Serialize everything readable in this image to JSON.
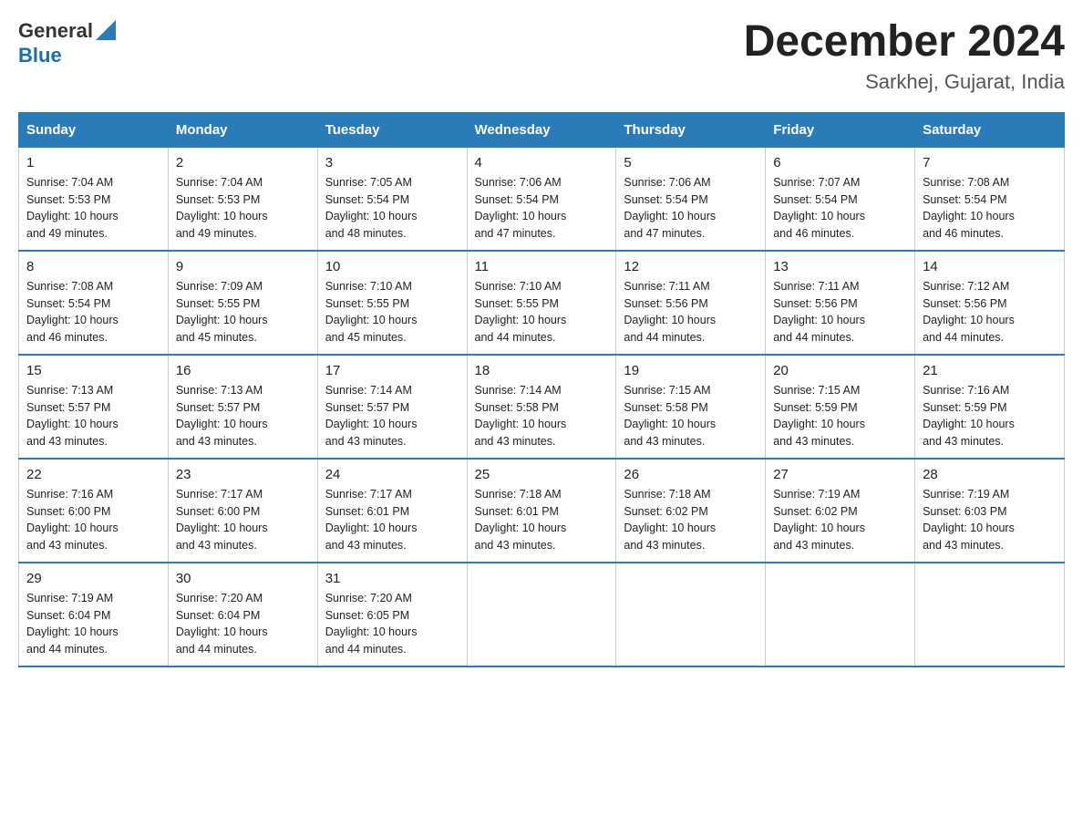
{
  "header": {
    "logo": {
      "text_general": "General",
      "text_blue": "Blue"
    },
    "title": "December 2024",
    "location": "Sarkhej, Gujarat, India"
  },
  "days_of_week": [
    "Sunday",
    "Monday",
    "Tuesday",
    "Wednesday",
    "Thursday",
    "Friday",
    "Saturday"
  ],
  "weeks": [
    [
      {
        "day": "1",
        "sunrise": "7:04 AM",
        "sunset": "5:53 PM",
        "daylight": "10 hours and 49 minutes."
      },
      {
        "day": "2",
        "sunrise": "7:04 AM",
        "sunset": "5:53 PM",
        "daylight": "10 hours and 49 minutes."
      },
      {
        "day": "3",
        "sunrise": "7:05 AM",
        "sunset": "5:54 PM",
        "daylight": "10 hours and 48 minutes."
      },
      {
        "day": "4",
        "sunrise": "7:06 AM",
        "sunset": "5:54 PM",
        "daylight": "10 hours and 47 minutes."
      },
      {
        "day": "5",
        "sunrise": "7:06 AM",
        "sunset": "5:54 PM",
        "daylight": "10 hours and 47 minutes."
      },
      {
        "day": "6",
        "sunrise": "7:07 AM",
        "sunset": "5:54 PM",
        "daylight": "10 hours and 46 minutes."
      },
      {
        "day": "7",
        "sunrise": "7:08 AM",
        "sunset": "5:54 PM",
        "daylight": "10 hours and 46 minutes."
      }
    ],
    [
      {
        "day": "8",
        "sunrise": "7:08 AM",
        "sunset": "5:54 PM",
        "daylight": "10 hours and 46 minutes."
      },
      {
        "day": "9",
        "sunrise": "7:09 AM",
        "sunset": "5:55 PM",
        "daylight": "10 hours and 45 minutes."
      },
      {
        "day": "10",
        "sunrise": "7:10 AM",
        "sunset": "5:55 PM",
        "daylight": "10 hours and 45 minutes."
      },
      {
        "day": "11",
        "sunrise": "7:10 AM",
        "sunset": "5:55 PM",
        "daylight": "10 hours and 44 minutes."
      },
      {
        "day": "12",
        "sunrise": "7:11 AM",
        "sunset": "5:56 PM",
        "daylight": "10 hours and 44 minutes."
      },
      {
        "day": "13",
        "sunrise": "7:11 AM",
        "sunset": "5:56 PM",
        "daylight": "10 hours and 44 minutes."
      },
      {
        "day": "14",
        "sunrise": "7:12 AM",
        "sunset": "5:56 PM",
        "daylight": "10 hours and 44 minutes."
      }
    ],
    [
      {
        "day": "15",
        "sunrise": "7:13 AM",
        "sunset": "5:57 PM",
        "daylight": "10 hours and 43 minutes."
      },
      {
        "day": "16",
        "sunrise": "7:13 AM",
        "sunset": "5:57 PM",
        "daylight": "10 hours and 43 minutes."
      },
      {
        "day": "17",
        "sunrise": "7:14 AM",
        "sunset": "5:57 PM",
        "daylight": "10 hours and 43 minutes."
      },
      {
        "day": "18",
        "sunrise": "7:14 AM",
        "sunset": "5:58 PM",
        "daylight": "10 hours and 43 minutes."
      },
      {
        "day": "19",
        "sunrise": "7:15 AM",
        "sunset": "5:58 PM",
        "daylight": "10 hours and 43 minutes."
      },
      {
        "day": "20",
        "sunrise": "7:15 AM",
        "sunset": "5:59 PM",
        "daylight": "10 hours and 43 minutes."
      },
      {
        "day": "21",
        "sunrise": "7:16 AM",
        "sunset": "5:59 PM",
        "daylight": "10 hours and 43 minutes."
      }
    ],
    [
      {
        "day": "22",
        "sunrise": "7:16 AM",
        "sunset": "6:00 PM",
        "daylight": "10 hours and 43 minutes."
      },
      {
        "day": "23",
        "sunrise": "7:17 AM",
        "sunset": "6:00 PM",
        "daylight": "10 hours and 43 minutes."
      },
      {
        "day": "24",
        "sunrise": "7:17 AM",
        "sunset": "6:01 PM",
        "daylight": "10 hours and 43 minutes."
      },
      {
        "day": "25",
        "sunrise": "7:18 AM",
        "sunset": "6:01 PM",
        "daylight": "10 hours and 43 minutes."
      },
      {
        "day": "26",
        "sunrise": "7:18 AM",
        "sunset": "6:02 PM",
        "daylight": "10 hours and 43 minutes."
      },
      {
        "day": "27",
        "sunrise": "7:19 AM",
        "sunset": "6:02 PM",
        "daylight": "10 hours and 43 minutes."
      },
      {
        "day": "28",
        "sunrise": "7:19 AM",
        "sunset": "6:03 PM",
        "daylight": "10 hours and 43 minutes."
      }
    ],
    [
      {
        "day": "29",
        "sunrise": "7:19 AM",
        "sunset": "6:04 PM",
        "daylight": "10 hours and 44 minutes."
      },
      {
        "day": "30",
        "sunrise": "7:20 AM",
        "sunset": "6:04 PM",
        "daylight": "10 hours and 44 minutes."
      },
      {
        "day": "31",
        "sunrise": "7:20 AM",
        "sunset": "6:05 PM",
        "daylight": "10 hours and 44 minutes."
      },
      null,
      null,
      null,
      null
    ]
  ]
}
